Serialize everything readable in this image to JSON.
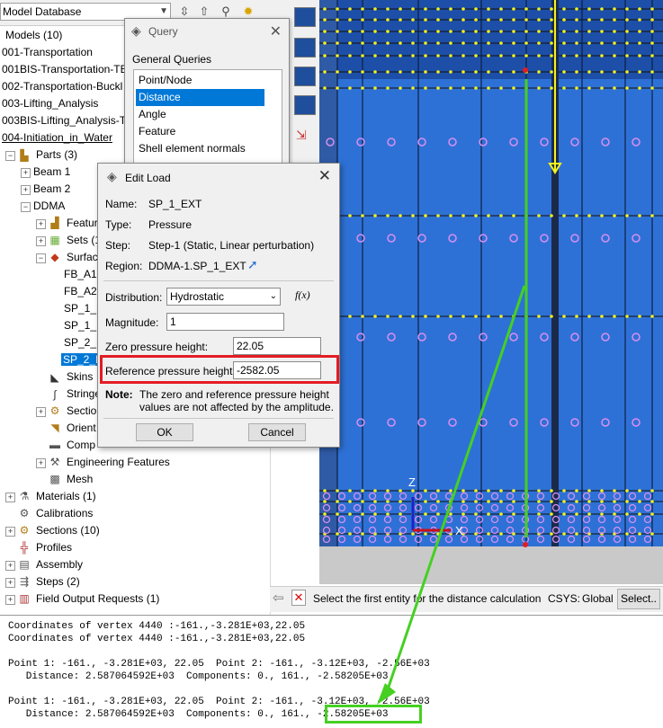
{
  "model_tree": {
    "combo_value": "Model Database",
    "items": [
      {
        "label": "Models (10)"
      },
      {
        "label": "001-Transportation"
      },
      {
        "label": "001BIS-Transportation-TE"
      },
      {
        "label": "002-Transportation-Buckl"
      },
      {
        "label": "003-Lifting_Analysis"
      },
      {
        "label": "003BIS-Lifting_Analysis-TI"
      },
      {
        "label": "004-Initiation_in_Water"
      },
      {
        "label": "Parts (3)"
      },
      {
        "label": "Beam 1"
      },
      {
        "label": "Beam 2"
      },
      {
        "label": "DDMA"
      },
      {
        "label": "Featur"
      },
      {
        "label": "Sets (1"
      },
      {
        "label": "Surfac"
      },
      {
        "label": "FB_A1"
      },
      {
        "label": "FB_A2"
      },
      {
        "label": "SP_1_E"
      },
      {
        "label": "SP_1_IN"
      },
      {
        "label": "SP_2_E"
      },
      {
        "label": "SP_2_I"
      },
      {
        "label": "Skins"
      },
      {
        "label": "Stringe"
      },
      {
        "label": "Sectio"
      },
      {
        "label": "Orient"
      },
      {
        "label": "Comp"
      },
      {
        "label": "Engineering Features"
      },
      {
        "label": "Mesh"
      },
      {
        "label": "Materials (1)"
      },
      {
        "label": "Calibrations"
      },
      {
        "label": "Sections (10)"
      },
      {
        "label": "Profiles"
      },
      {
        "label": "Assembly"
      },
      {
        "label": "Steps (2)"
      },
      {
        "label": "Field Output Requests (1)"
      }
    ]
  },
  "query_dialog": {
    "title": "Query",
    "group_label": "General Queries",
    "items": [
      "Point/Node",
      "Distance",
      "Angle",
      "Feature",
      "Shell element normals"
    ],
    "selected": "Distance"
  },
  "edit_load": {
    "title": "Edit Load",
    "name_label": "Name:",
    "name_value": "SP_1_EXT",
    "type_label": "Type:",
    "type_value": "Pressure",
    "step_label": "Step:",
    "step_value": "Step-1 (Static, Linear perturbation)",
    "region_label": "Region:",
    "region_value": "DDMA-1.SP_1_EXT",
    "distribution_label": "Distribution:",
    "distribution_value": "Hydrostatic",
    "fx_label": "f(x)",
    "magnitude_label": "Magnitude:",
    "magnitude_value": "1",
    "zero_label": "Zero pressure height:",
    "zero_value": "22.05",
    "ref_label": "Reference pressure height:",
    "ref_value": "-2582.05",
    "note_label": "Note:",
    "note_line1": "The zero and reference pressure height",
    "note_line2": "values are not affected by the amplitude.",
    "ok": "OK",
    "cancel": "Cancel"
  },
  "viewport": {
    "axis_z": "Z",
    "axis_x": "X"
  },
  "prompt": {
    "text": "Select the first entity for the distance calculation",
    "csys_label": "CSYS:",
    "csys_value": "Global",
    "select_button": "Select.."
  },
  "messages": [
    "Coordinates of vertex 4440 :-161.,-3.281E+03,22.05",
    "Coordinates of vertex 4440 :-161.,-3.281E+03,22.05",
    "",
    "Point 1: -161., -3.281E+03, 22.05  Point 2: -161., -3.12E+03, -2.56E+03",
    "   Distance: 2.587064592E+03  Components: 0., 161., -2.58205E+03",
    "",
    "Point 1: -161., -3.281E+03, 22.05  Point 2: -161., -3.12E+03, -2.56E+03",
    "   Distance: 2.587064592E+03  Components: 0., 161., -2.58205E+03"
  ],
  "colors": {
    "viewport_blue": "#2e71d6",
    "mesh_yellow": "#f4f21e",
    "node_purple": "#d88ff0",
    "highlight_red": "#e31c23",
    "highlight_green": "#45d022",
    "selection_blue": "#0078d7"
  }
}
